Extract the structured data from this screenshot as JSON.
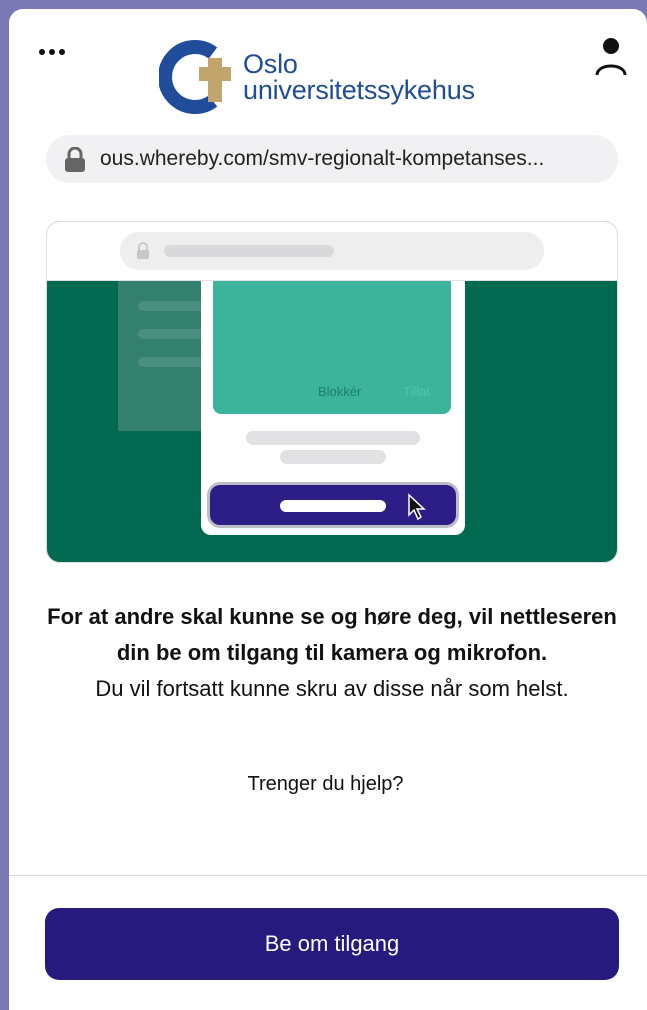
{
  "header": {
    "menu_icon": "ellipsis-icon",
    "profile_icon": "user-icon",
    "logo": {
      "line1": "Oslo",
      "line2": "universitetssykehus",
      "colors": {
        "ring": "#1f4d9a",
        "cross": "#c2a56c"
      }
    }
  },
  "url_bar": {
    "icon": "lock-icon",
    "text": "ous.whereby.com/smv-regionalt-kompetanses..."
  },
  "illustration": {
    "dialog_block_label": "Blokkér",
    "dialog_allow_label": "Tillat",
    "colors": {
      "background": "#01694f",
      "dialog_accent": "#3cb49b",
      "button": "#2c1d87"
    }
  },
  "message": {
    "bold_text": "For at andre skal kunne se og høre deg, vil nettleseren din be om tilgang til kamera og mikrofon.",
    "regular_text": "Du vil fortsatt kunne skru av disse når som helst."
  },
  "help_link": "Trenger du hjelp?",
  "primary_button": {
    "label": "Be om tilgang",
    "color": "#271a7f"
  }
}
